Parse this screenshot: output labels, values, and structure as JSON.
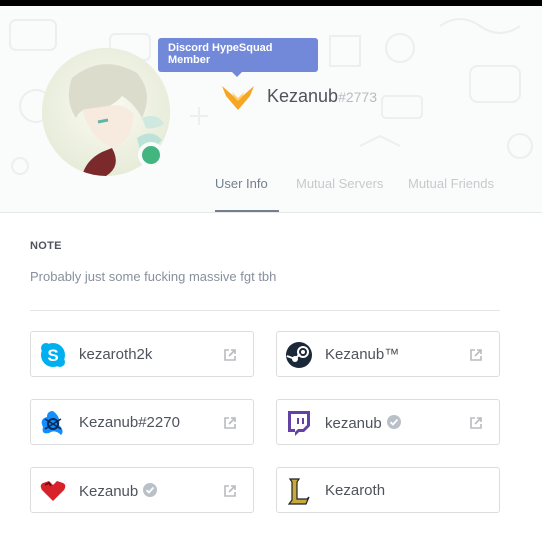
{
  "tooltip": {
    "text": "Discord HypeSquad Member"
  },
  "user": {
    "name": "Kezanub",
    "discriminator": "#2773",
    "status_color": "#43b581"
  },
  "tabs": [
    {
      "label": "User Info"
    },
    {
      "label": "Mutual Servers"
    },
    {
      "label": "Mutual Friends"
    }
  ],
  "note": {
    "title": "NOTE",
    "text": "Probably just some fucking massive fgt tbh"
  },
  "accounts": [
    {
      "service": "skype",
      "name": "kezaroth2k",
      "verified": false,
      "icon": "skype-icon"
    },
    {
      "service": "steam",
      "name": "Kezanub™",
      "verified": false,
      "icon": "steam-icon"
    },
    {
      "service": "battlenet",
      "name": "Kezanub#2270",
      "verified": false,
      "icon": "battlenet-icon"
    },
    {
      "service": "twitch",
      "name": "kezanub",
      "verified": true,
      "icon": "twitch-icon"
    },
    {
      "service": "youtube",
      "name": "Kezanub",
      "verified": true,
      "icon": "youtube-heart-icon"
    },
    {
      "service": "league",
      "name": "Kezaroth",
      "verified": false,
      "icon": "league-of-legends-icon"
    }
  ],
  "colors": {
    "accent": "#7289da",
    "hypesquad": "#f5a623",
    "twitch": "#6441a4",
    "skype": "#00aff0"
  }
}
